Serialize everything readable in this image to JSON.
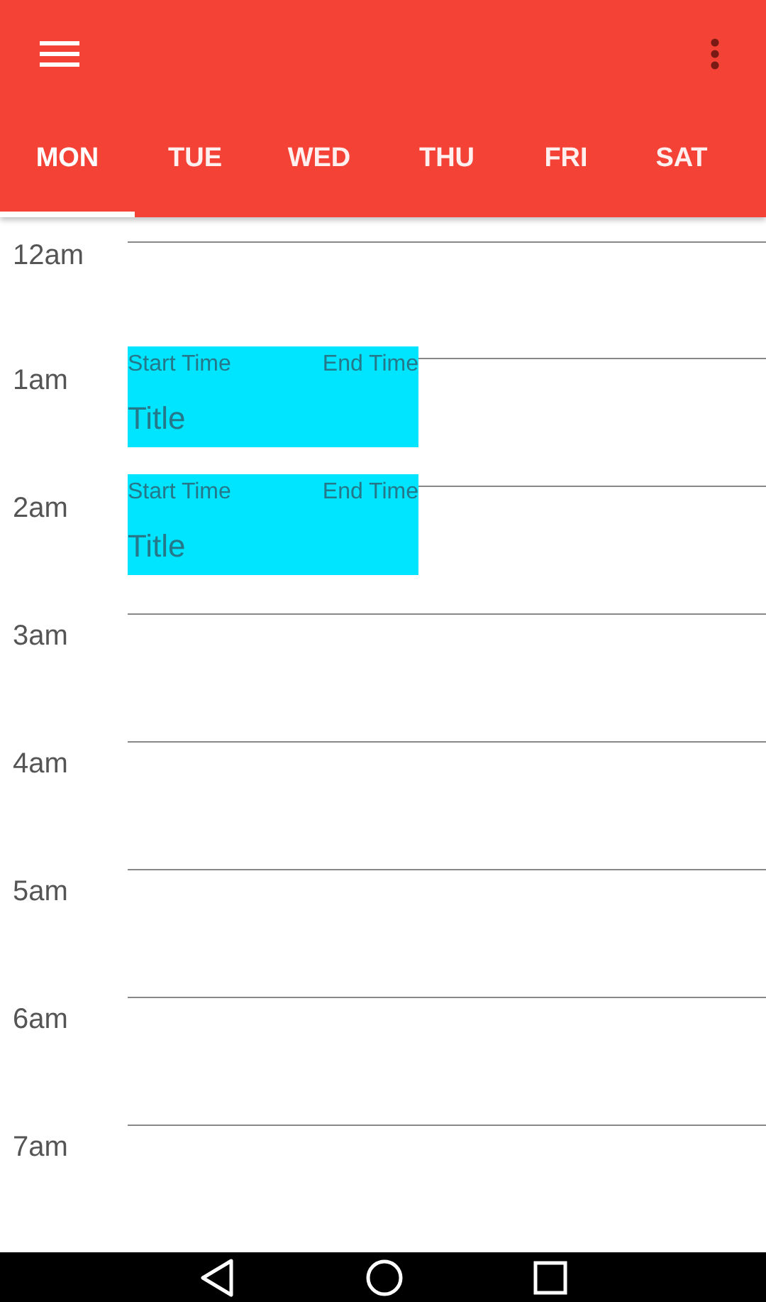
{
  "tabs": [
    {
      "label": "MON",
      "selected": true
    },
    {
      "label": "TUE",
      "selected": false
    },
    {
      "label": "WED",
      "selected": false
    },
    {
      "label": "THU",
      "selected": false
    },
    {
      "label": "FRI",
      "selected": false
    },
    {
      "label": "SAT",
      "selected": false
    }
  ],
  "hours": [
    {
      "label": "12am"
    },
    {
      "label": "1am",
      "events": [
        {
          "start": "Start Time",
          "end": "End Time",
          "title": "Title"
        }
      ]
    },
    {
      "label": "2am",
      "events": [
        {
          "start": "Start Time",
          "end": "End Time",
          "title": "Title"
        }
      ]
    },
    {
      "label": "3am"
    },
    {
      "label": "4am"
    },
    {
      "label": "5am"
    },
    {
      "label": "6am"
    },
    {
      "label": "7am"
    }
  ]
}
